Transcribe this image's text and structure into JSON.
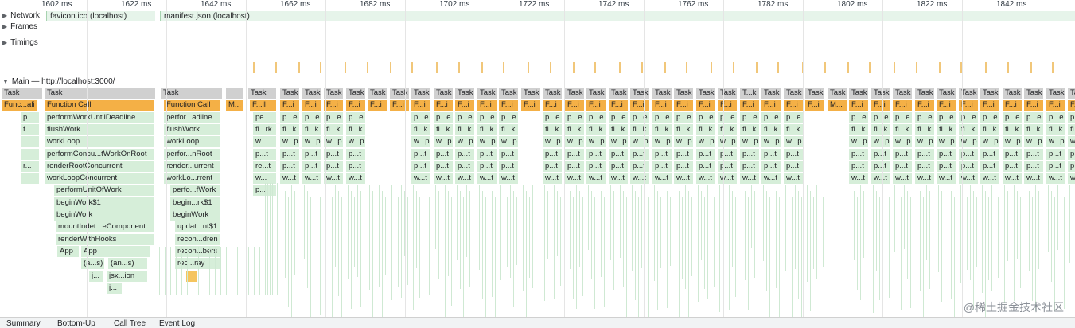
{
  "ruler": {
    "ticks": [
      "1602 ms",
      "1622 ms",
      "1642 ms",
      "1662 ms",
      "1682 ms",
      "1702 ms",
      "1722 ms",
      "1742 ms",
      "1762 ms",
      "1782 ms",
      "1802 ms",
      "1822 ms",
      "1842 ms"
    ]
  },
  "tracks": {
    "network": "Network",
    "frames": "Frames",
    "timings": "Timings",
    "main": "Main — http://localhost:3000/"
  },
  "network": {
    "requests": [
      "favicon.ico (localhost)",
      "manifest.json (localhost)"
    ]
  },
  "flame": {
    "task_label": "Task",
    "col1": [
      "Func...ali",
      "",
      "",
      "",
      "",
      "",
      "",
      "",
      "",
      "",
      "",
      ""
    ],
    "col2": [
      "Function Call",
      "performWorkUntilDeadline",
      "flushWork",
      "workLoop",
      "performConcu...tWorkOnRoot",
      "renderRootConcurrent",
      "workLoopConcurrent",
      "performUnitOfWork",
      "beginWork$1",
      "beginWork",
      "mountIndet...eComponent",
      "renderWithHooks"
    ],
    "col2_app": [
      "App",
      "App"
    ],
    "col2_sub": [
      "(a...s)",
      "(an...s)",
      "j...",
      "jsx...ion",
      "j..."
    ],
    "col3": [
      "Function Call",
      "perfor...adline",
      "flushWork",
      "workLoop",
      "perfor...nRoot",
      "render...urrent",
      "workLo...rrent",
      "perfo...fWork",
      "begin...rk$1",
      "beginWork",
      "updat...nt$1",
      "recon...dren",
      "recon...bers",
      "rec...ray"
    ],
    "col4": [
      "pe...",
      "fl...rk",
      "w...",
      "p...t",
      "re...t",
      "w...",
      "p..."
    ],
    "small_col": [
      "F...i",
      "p...e",
      "fl...k",
      "w...p",
      "p...t",
      "p...t",
      "w...t"
    ],
    "truncated_top": [
      "M...",
      "T...k",
      "M..."
    ]
  },
  "bottom_tabs": [
    "Summary",
    "Bottom-Up",
    "Call Tree",
    "Event Log"
  ],
  "watermark": "@稀土掘金技术社区",
  "colors": {
    "task": "#d0d0d0",
    "function_call": "#f4b046",
    "js_green": "#d6eed9",
    "timing_mark": "#f1c77a"
  }
}
